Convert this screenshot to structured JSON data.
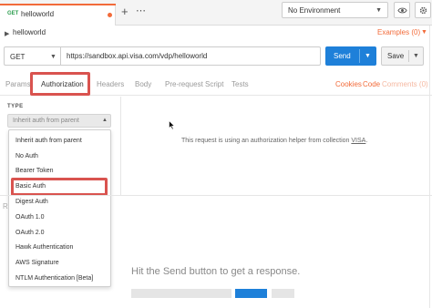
{
  "tab": {
    "method": "GET",
    "title": "helloworld",
    "plus": "+",
    "more": "⋯"
  },
  "env": {
    "label": "No Environment",
    "caret": "▼"
  },
  "request": {
    "caret": "▶",
    "name": "helloworld",
    "examples": "Examples (0)",
    "examples_caret": "▼"
  },
  "url_bar": {
    "method": "GET",
    "method_caret": "▼",
    "url": "https://sandbox.api.visa.com/vdp/helloworld",
    "send": "Send",
    "send_caret": "▼",
    "save": "Save",
    "save_caret": "▼"
  },
  "req_tabs": {
    "params": "Params",
    "authorization": "Authorization",
    "headers": "Headers",
    "body": "Body",
    "prerequest": "Pre-request Script",
    "tests": "Tests",
    "cookies": "Cookies",
    "code": "Code",
    "comments": "Comments (0)"
  },
  "auth": {
    "type_label": "TYPE",
    "selected": "Inherit auth from parent",
    "caret": "▲",
    "helper_text": "This request is using an authorization helper from collection ",
    "helper_link": "VISA",
    "helper_end": ".",
    "options": [
      "Inherit auth from parent",
      "No Auth",
      "Bearer Token",
      "Basic Auth",
      "Digest Auth",
      "OAuth 1.0",
      "OAuth 2.0",
      "Hawk Authentication",
      "AWS Signature",
      "NTLM Authentication [Beta]"
    ]
  },
  "response": {
    "stub": "R",
    "message": "Hit the Send button to get a response."
  },
  "colors": {
    "accent": "#f26b3a",
    "primary": "#1e80d9",
    "highlight": "#d9534f",
    "get_method": "#2d9e4f"
  },
  "icons": {
    "eye": "eye-icon",
    "gear": "gear-icon",
    "cursor": "cursor-icon"
  }
}
